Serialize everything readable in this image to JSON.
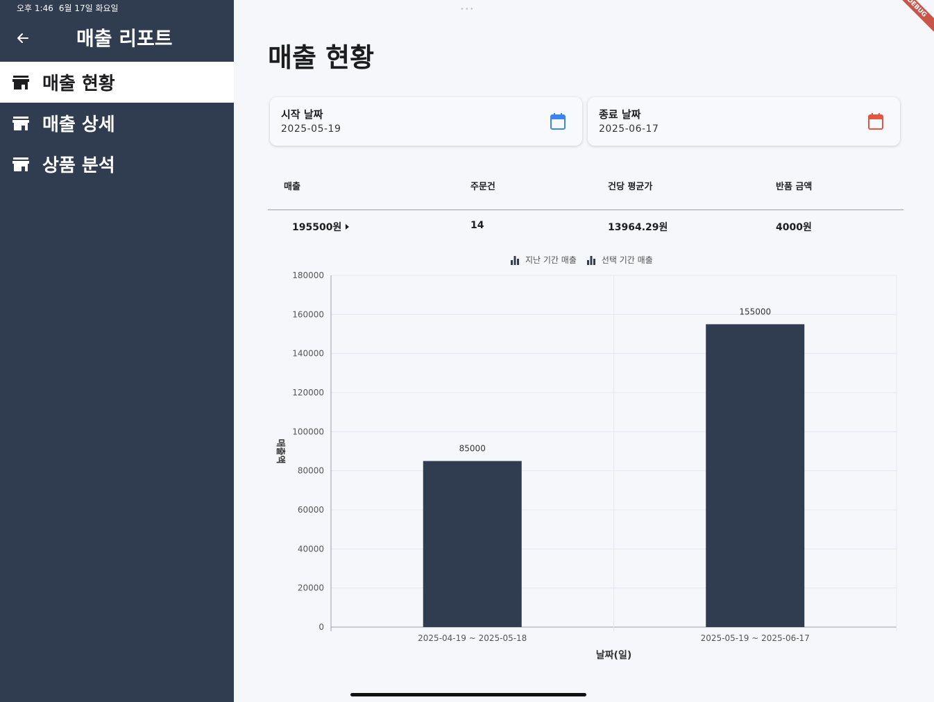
{
  "status": {
    "time": "오후 1:46",
    "date": "6월 17일 화요일"
  },
  "sidebar": {
    "title": "매출 리포트",
    "items": [
      {
        "label": "매출 현황",
        "icon": "store-icon",
        "active": true
      },
      {
        "label": "매출 상세",
        "icon": "store-icon",
        "active": false
      },
      {
        "label": "상품 분석",
        "icon": "store-icon",
        "active": false
      }
    ]
  },
  "main": {
    "title": "매출 현황",
    "start_date": {
      "label": "시작 날짜",
      "value": "2025-05-19",
      "icon": "calendar-icon",
      "color": "#3b82f6"
    },
    "end_date": {
      "label": "종료 날짜",
      "value": "2025-06-17",
      "icon": "calendar-icon",
      "color": "#e8553f"
    },
    "summary": {
      "headers": [
        "매출",
        "주문건",
        "건당 평균가",
        "반품 금액"
      ],
      "values": [
        "195500원",
        "14",
        "13964.29원",
        "4000원"
      ]
    }
  },
  "chart_data": {
    "type": "bar",
    "categories": [
      "2025-04-19 ~ 2025-05-18",
      "2025-05-19 ~ 2025-06-17"
    ],
    "values": [
      85000,
      155000
    ],
    "data_labels": [
      "85000",
      "155000"
    ],
    "legend": [
      "지난 기간 매출",
      "선택 기간 매출"
    ],
    "xlabel": "날짜(일)",
    "ylabel": "매출액",
    "ylim": [
      0,
      180000
    ],
    "yticks": [
      0,
      20000,
      40000,
      60000,
      80000,
      100000,
      120000,
      140000,
      160000,
      180000
    ],
    "bar_color": "#303d50",
    "grid": true,
    "legend_position": "top-center"
  }
}
